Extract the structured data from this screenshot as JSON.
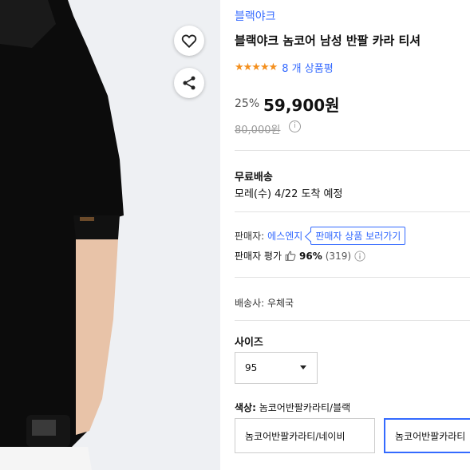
{
  "product": {
    "brand": "블랙야크",
    "title": "블랙야크 놈코어 남성 반팔 카라 티셔",
    "stars": "★★★★★",
    "reviews": "8 개 상품평",
    "discount": "25%",
    "price": "59,900원",
    "original_price": "80,000원",
    "info_icon": "i"
  },
  "shipping": {
    "title": "무료배송",
    "eta": "모레(수) 4/22 도착 예정"
  },
  "seller": {
    "label": "판매자:",
    "name": "에스엔지",
    "view_products": "판매자 상품 보러가기",
    "rating_label": "판매자 평가",
    "rating_pct": "96%",
    "rating_count": "(319)"
  },
  "carrier": {
    "text": "배송사:  우체국"
  },
  "options": {
    "size_label": "사이즈",
    "size_value": "95",
    "color_label": "색상:",
    "color_value": "놈코어반팔카라티/블랙",
    "color_options": [
      "놈코어반팔카라티/네이비",
      "놈코어반팔카라티"
    ]
  },
  "icons": {
    "wishlist": "heart-icon",
    "share": "share-icon"
  },
  "colors": {
    "accent": "#346aff",
    "star": "#f48f1d"
  }
}
